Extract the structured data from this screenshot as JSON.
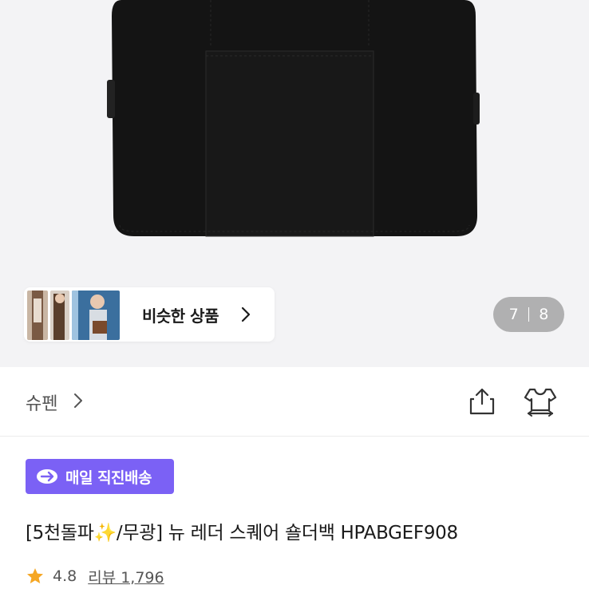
{
  "similar": {
    "label": "비슷한 상품"
  },
  "pager": {
    "current": "7",
    "total": "8"
  },
  "shop": {
    "name": "슈펜"
  },
  "badge": {
    "label": "매일 직진배송",
    "color": "#7b61f5"
  },
  "product": {
    "title": "[5천돌파✨/무광] 뉴 레더 스퀘어 숄더백 HPABGEF908",
    "rating": "4.8",
    "reviews": "리뷰 1,796"
  },
  "icons": [
    "chevron-right-icon",
    "share-icon",
    "hanger-icon",
    "truck-badge-icon",
    "star-icon"
  ]
}
